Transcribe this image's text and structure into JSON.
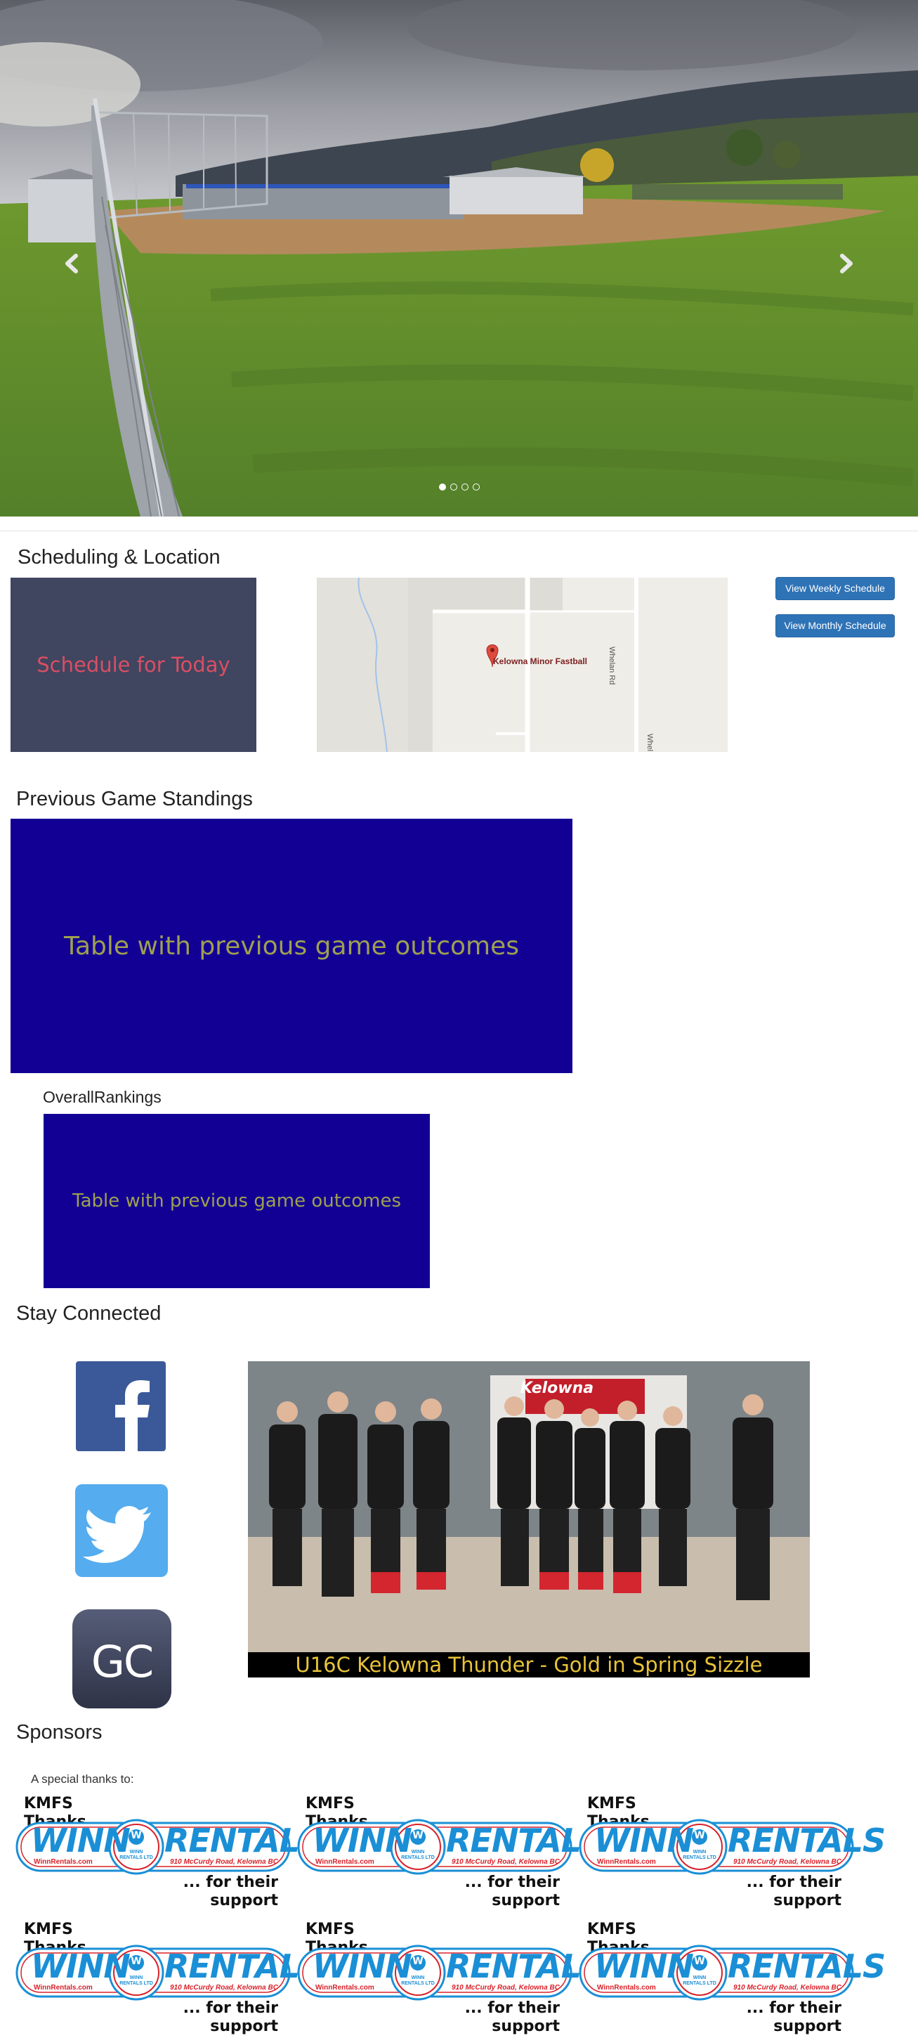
{
  "carousel": {
    "prev_icon": "chevron-left-icon",
    "next_icon": "chevron-right-icon",
    "slide_count": 4,
    "active_slide": 1
  },
  "scheduling": {
    "heading": "Scheduling & Location",
    "schedule_placeholder": "Schedule for Today",
    "map": {
      "marker_label": "Kelowna Minor Fastball",
      "road_label": "Whelan Rd",
      "road_label_partial": "Whel"
    },
    "buttons": {
      "weekly": "View Weekly Schedule",
      "monthly": "View Monthly Schedule"
    }
  },
  "standings": {
    "heading": "Previous Game Standings",
    "table_placeholder": "Table with previous game outcomes",
    "overall_heading": "OverallRankings",
    "overall_placeholder": "Table with previous game outcomes"
  },
  "social": {
    "heading": "Stay Connected",
    "icons": [
      "facebook-icon",
      "twitter-icon",
      "gamechanger-icon"
    ],
    "gamechanger_text": "GC",
    "photo_caption": "U16C Kelowna Thunder - Gold in Spring Sizzle",
    "banner_text": "Kelowna"
  },
  "sponsors": {
    "heading": "Sponsors",
    "intro": "A special thanks to:",
    "card": {
      "thanks": "KMFS\nThanks ...",
      "word_left": "WINN",
      "word_right": "RENTALS",
      "url": "WinnRentals.com",
      "badge_top": "W",
      "badge_text": "WINN RENTALS LTD",
      "address": "910 McCurdy Road, Kelowna BC",
      "support": "... for their\nsupport"
    }
  },
  "colors": {
    "button_blue": "#2f73b7",
    "schedule_bg": "#404560",
    "schedule_text": "#d94f63",
    "table_blue": "#120094",
    "table_text": "#9ea050",
    "facebook": "#3b5998",
    "twitter": "#55acee",
    "winn_blue": "#1a8fd6",
    "winn_red": "#d8222a",
    "caption_yellow": "#e8c33a"
  }
}
